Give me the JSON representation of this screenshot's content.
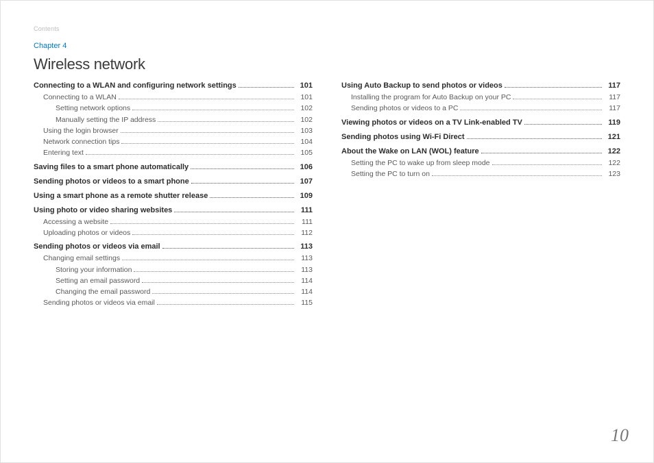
{
  "header": {
    "running_head": "Contents",
    "chapter_label": "Chapter 4",
    "chapter_title": "Wireless network"
  },
  "page_number": "10",
  "toc": {
    "left": [
      {
        "level": 0,
        "title": "Connecting to a WLAN and configuring network settings",
        "page": "101"
      },
      {
        "level": 1,
        "title": "Connecting to a WLAN",
        "page": "101"
      },
      {
        "level": 2,
        "title": "Setting network options",
        "page": "102"
      },
      {
        "level": 2,
        "title": "Manually setting the IP address",
        "page": "102"
      },
      {
        "level": 1,
        "title": "Using the login browser",
        "page": "103"
      },
      {
        "level": 1,
        "title": "Network connection tips",
        "page": "104"
      },
      {
        "level": 1,
        "title": "Entering text",
        "page": "105"
      },
      {
        "level": 0,
        "title": "Saving files to a smart phone automatically",
        "page": "106"
      },
      {
        "level": 0,
        "title": "Sending photos or videos to a smart phone",
        "page": "107"
      },
      {
        "level": 0,
        "title": "Using a smart phone as a remote shutter release",
        "page": "109"
      },
      {
        "level": 0,
        "title": "Using photo or video sharing websites",
        "page": "111"
      },
      {
        "level": 1,
        "title": "Accessing a website",
        "page": "111"
      },
      {
        "level": 1,
        "title": "Uploading photos or videos",
        "page": "112"
      },
      {
        "level": 0,
        "title": "Sending photos or videos via email",
        "page": "113"
      },
      {
        "level": 1,
        "title": "Changing email settings",
        "page": "113"
      },
      {
        "level": 2,
        "title": "Storing your information",
        "page": "113"
      },
      {
        "level": 2,
        "title": "Setting an email password",
        "page": "114"
      },
      {
        "level": 2,
        "title": "Changing the email password",
        "page": "114"
      },
      {
        "level": 1,
        "title": "Sending photos or videos via email",
        "page": "115"
      }
    ],
    "right": [
      {
        "level": 0,
        "title": "Using Auto Backup to send photos or videos",
        "page": "117"
      },
      {
        "level": 1,
        "title": "Installing the program for Auto Backup on your PC",
        "page": "117"
      },
      {
        "level": 1,
        "title": "Sending photos or videos to a PC",
        "page": "117"
      },
      {
        "level": 0,
        "title": "Viewing photos or videos on a TV Link-enabled TV",
        "page": "119"
      },
      {
        "level": 0,
        "title": "Sending photos using Wi-Fi Direct",
        "page": "121"
      },
      {
        "level": 0,
        "title": "About the Wake on LAN (WOL) feature",
        "page": "122"
      },
      {
        "level": 1,
        "title": "Setting the PC to wake up from sleep mode",
        "page": "122"
      },
      {
        "level": 1,
        "title": "Setting the PC to turn on",
        "page": "123"
      }
    ]
  }
}
